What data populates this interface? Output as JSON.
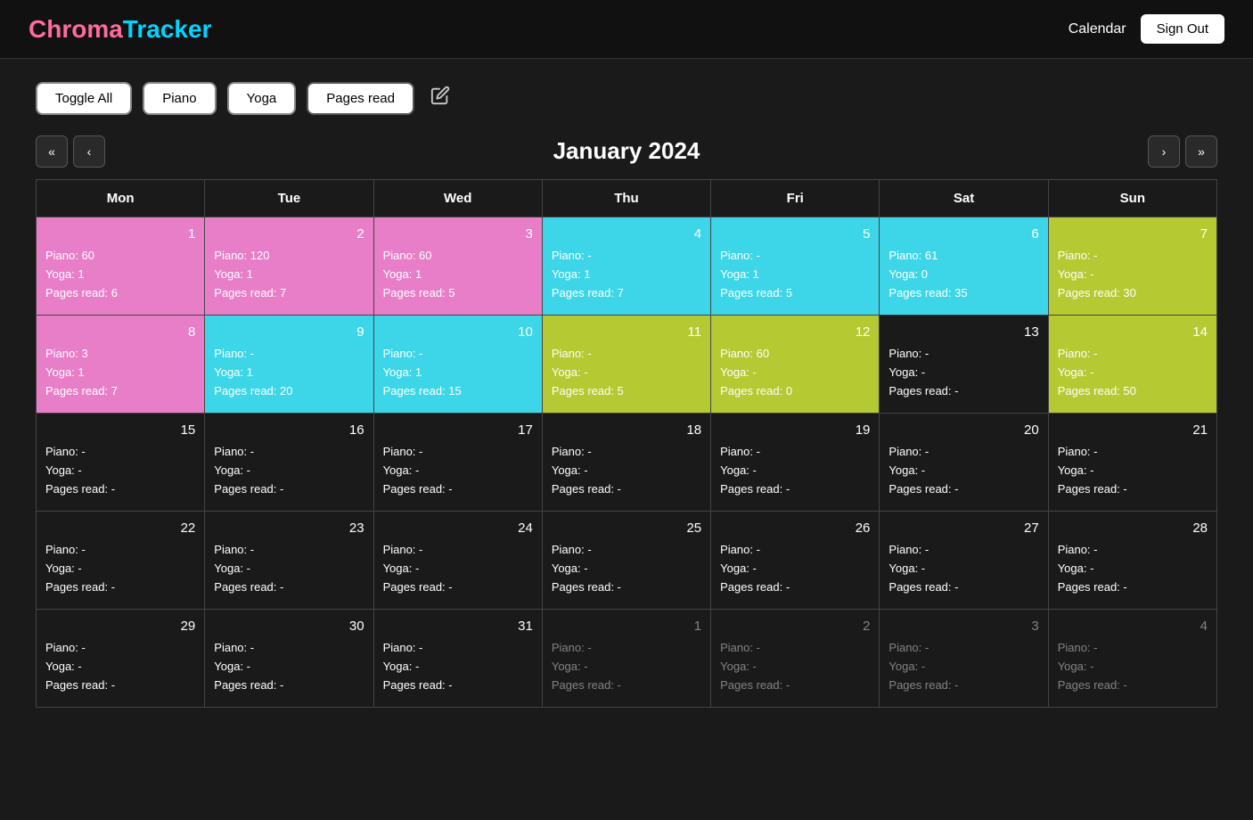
{
  "header": {
    "logo_chroma": "Chroma",
    "logo_tracker": "Tracker",
    "calendar_link": "Calendar",
    "sign_out_label": "Sign Out"
  },
  "filters": {
    "toggle_all": "Toggle All",
    "piano": "Piano",
    "yoga": "Yoga",
    "pages_read": "Pages read",
    "edit_icon": "✎"
  },
  "calendar": {
    "title": "January 2024",
    "nav": {
      "prev_prev": "«",
      "prev": "‹",
      "next": "›",
      "next_next": "»"
    },
    "weekdays": [
      "Mon",
      "Tue",
      "Wed",
      "Thu",
      "Fri",
      "Sat",
      "Sun"
    ],
    "weeks": [
      [
        {
          "day": "1",
          "piano": "60",
          "yoga": "1",
          "pages": "6",
          "color": "pink",
          "outside": false
        },
        {
          "day": "2",
          "piano": "120",
          "yoga": "1",
          "pages": "7",
          "color": "pink",
          "outside": false
        },
        {
          "day": "3",
          "piano": "60",
          "yoga": "1",
          "pages": "5",
          "color": "pink",
          "outside": false
        },
        {
          "day": "4",
          "piano": "-",
          "yoga": "1",
          "pages": "7",
          "color": "cyan",
          "outside": false
        },
        {
          "day": "5",
          "piano": "-",
          "yoga": "1",
          "pages": "5",
          "color": "cyan",
          "outside": false
        },
        {
          "day": "6",
          "piano": "61",
          "yoga": "0",
          "pages": "35",
          "color": "cyan",
          "outside": false
        },
        {
          "day": "7",
          "piano": "-",
          "yoga": "-",
          "pages": "30",
          "color": "yellow-green",
          "outside": false
        }
      ],
      [
        {
          "day": "8",
          "piano": "3",
          "yoga": "1",
          "pages": "7",
          "color": "pink",
          "outside": false
        },
        {
          "day": "9",
          "piano": "-",
          "yoga": "1",
          "pages": "20",
          "color": "cyan",
          "outside": false
        },
        {
          "day": "10",
          "piano": "-",
          "yoga": "1",
          "pages": "15",
          "color": "cyan",
          "outside": false
        },
        {
          "day": "11",
          "piano": "-",
          "yoga": "-",
          "pages": "5",
          "color": "yellow-green",
          "outside": false
        },
        {
          "day": "12",
          "piano": "60",
          "yoga": "-",
          "pages": "0",
          "color": "yellow-green",
          "outside": false
        },
        {
          "day": "13",
          "piano": "-",
          "yoga": "-",
          "pages": "-",
          "color": "dark",
          "outside": false
        },
        {
          "day": "14",
          "piano": "-",
          "yoga": "-",
          "pages": "50",
          "color": "yellow-green",
          "outside": false
        }
      ],
      [
        {
          "day": "15",
          "piano": "-",
          "yoga": "-",
          "pages": "-",
          "color": "dark",
          "outside": false
        },
        {
          "day": "16",
          "piano": "-",
          "yoga": "-",
          "pages": "-",
          "color": "dark",
          "outside": false
        },
        {
          "day": "17",
          "piano": "-",
          "yoga": "-",
          "pages": "-",
          "color": "dark",
          "outside": false
        },
        {
          "day": "18",
          "piano": "-",
          "yoga": "-",
          "pages": "-",
          "color": "dark",
          "outside": false
        },
        {
          "day": "19",
          "piano": "-",
          "yoga": "-",
          "pages": "-",
          "color": "dark",
          "outside": false
        },
        {
          "day": "20",
          "piano": "-",
          "yoga": "-",
          "pages": "-",
          "color": "dark",
          "outside": false
        },
        {
          "day": "21",
          "piano": "-",
          "yoga": "-",
          "pages": "-",
          "color": "dark",
          "outside": false
        }
      ],
      [
        {
          "day": "22",
          "piano": "-",
          "yoga": "-",
          "pages": "-",
          "color": "dark",
          "outside": false
        },
        {
          "day": "23",
          "piano": "-",
          "yoga": "-",
          "pages": "-",
          "color": "dark",
          "outside": false
        },
        {
          "day": "24",
          "piano": "-",
          "yoga": "-",
          "pages": "-",
          "color": "dark",
          "outside": false
        },
        {
          "day": "25",
          "piano": "-",
          "yoga": "-",
          "pages": "-",
          "color": "dark",
          "outside": false
        },
        {
          "day": "26",
          "piano": "-",
          "yoga": "-",
          "pages": "-",
          "color": "dark",
          "outside": false
        },
        {
          "day": "27",
          "piano": "-",
          "yoga": "-",
          "pages": "-",
          "color": "dark",
          "outside": false
        },
        {
          "day": "28",
          "piano": "-",
          "yoga": "-",
          "pages": "-",
          "color": "dark",
          "outside": false
        }
      ],
      [
        {
          "day": "29",
          "piano": "-",
          "yoga": "-",
          "pages": "-",
          "color": "dark",
          "outside": false
        },
        {
          "day": "30",
          "piano": "-",
          "yoga": "-",
          "pages": "-",
          "color": "dark",
          "outside": false
        },
        {
          "day": "31",
          "piano": "-",
          "yoga": "-",
          "pages": "-",
          "color": "dark",
          "outside": false
        },
        {
          "day": "1",
          "piano": "-",
          "yoga": "-",
          "pages": "-",
          "color": "dark",
          "outside": true
        },
        {
          "day": "2",
          "piano": "-",
          "yoga": "-",
          "pages": "-",
          "color": "dark",
          "outside": true
        },
        {
          "day": "3",
          "piano": "-",
          "yoga": "-",
          "pages": "-",
          "color": "dark",
          "outside": true
        },
        {
          "day": "4",
          "piano": "-",
          "yoga": "-",
          "pages": "-",
          "color": "dark",
          "outside": true
        }
      ]
    ]
  }
}
